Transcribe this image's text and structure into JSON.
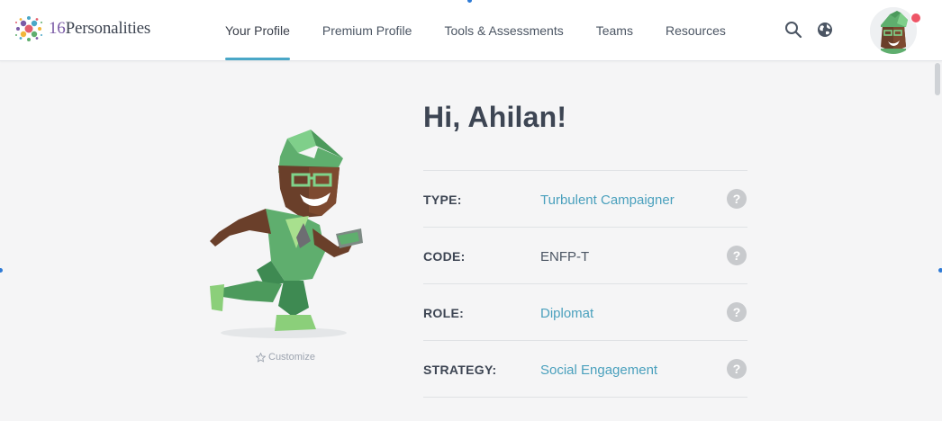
{
  "brand": {
    "number": "16",
    "name": "Personalities"
  },
  "nav": [
    {
      "label": "Your Profile",
      "active": true
    },
    {
      "label": "Premium Profile"
    },
    {
      "label": "Tools & Assessments"
    },
    {
      "label": "Teams"
    },
    {
      "label": "Resources"
    }
  ],
  "icons": {
    "search": "search-icon",
    "language": "globe-icon",
    "help": "help-icon",
    "customize": "star-icon"
  },
  "help_glyph": "?",
  "customize_label": "Customize",
  "greeting": "Hi, Ahilan!",
  "profile": [
    {
      "label": "TYPE:",
      "value": "Turbulent Campaigner",
      "link": true
    },
    {
      "label": "CODE:",
      "value": "ENFP-T",
      "link": false
    },
    {
      "label": "ROLE:",
      "value": "Diplomat",
      "link": true
    },
    {
      "label": "STRATEGY:",
      "value": "Social Engagement",
      "link": true
    }
  ],
  "colors": {
    "accent": "#4aa7c7",
    "link": "#4aa0bd",
    "notification": "#ee5566",
    "character_green": "#5fae6e"
  }
}
